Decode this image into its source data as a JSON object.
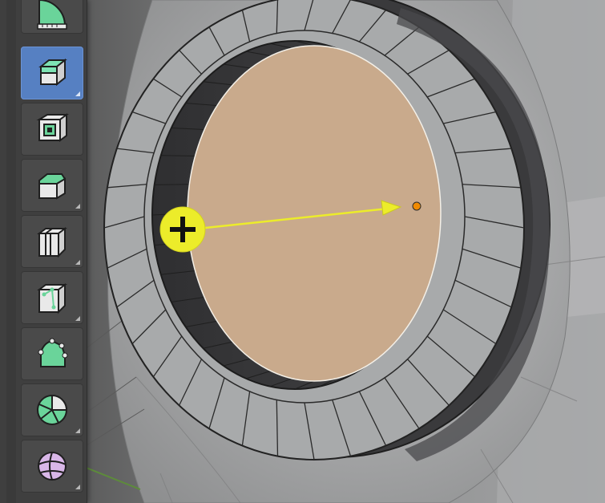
{
  "viewport": {
    "scene": "3d-mesh-cylinder-inset",
    "colors": {
      "background": "#4b4b4b",
      "face_fill": "#c9aa8c",
      "ring_light": "#a7a9aa",
      "ring_dark": "#3b3b3d",
      "wire": "#232323",
      "gizmo": "#ecec2a",
      "pivot": "#f08a00"
    }
  },
  "toolbar": {
    "tools": [
      {
        "icon": "measure-icon",
        "active": false,
        "has_submenu": false
      },
      {
        "icon": "extrude-region-icon",
        "active": true,
        "has_submenu": true
      },
      {
        "icon": "inset-faces-icon",
        "active": false,
        "has_submenu": false
      },
      {
        "icon": "bevel-icon",
        "active": false,
        "has_submenu": true
      },
      {
        "icon": "loop-cut-icon",
        "active": false,
        "has_submenu": true
      },
      {
        "icon": "knife-icon",
        "active": false,
        "has_submenu": true
      },
      {
        "icon": "poly-build-icon",
        "active": false,
        "has_submenu": false
      },
      {
        "icon": "spin-icon",
        "active": false,
        "has_submenu": true
      },
      {
        "icon": "smooth-icon",
        "active": false,
        "has_submenu": true
      }
    ]
  }
}
